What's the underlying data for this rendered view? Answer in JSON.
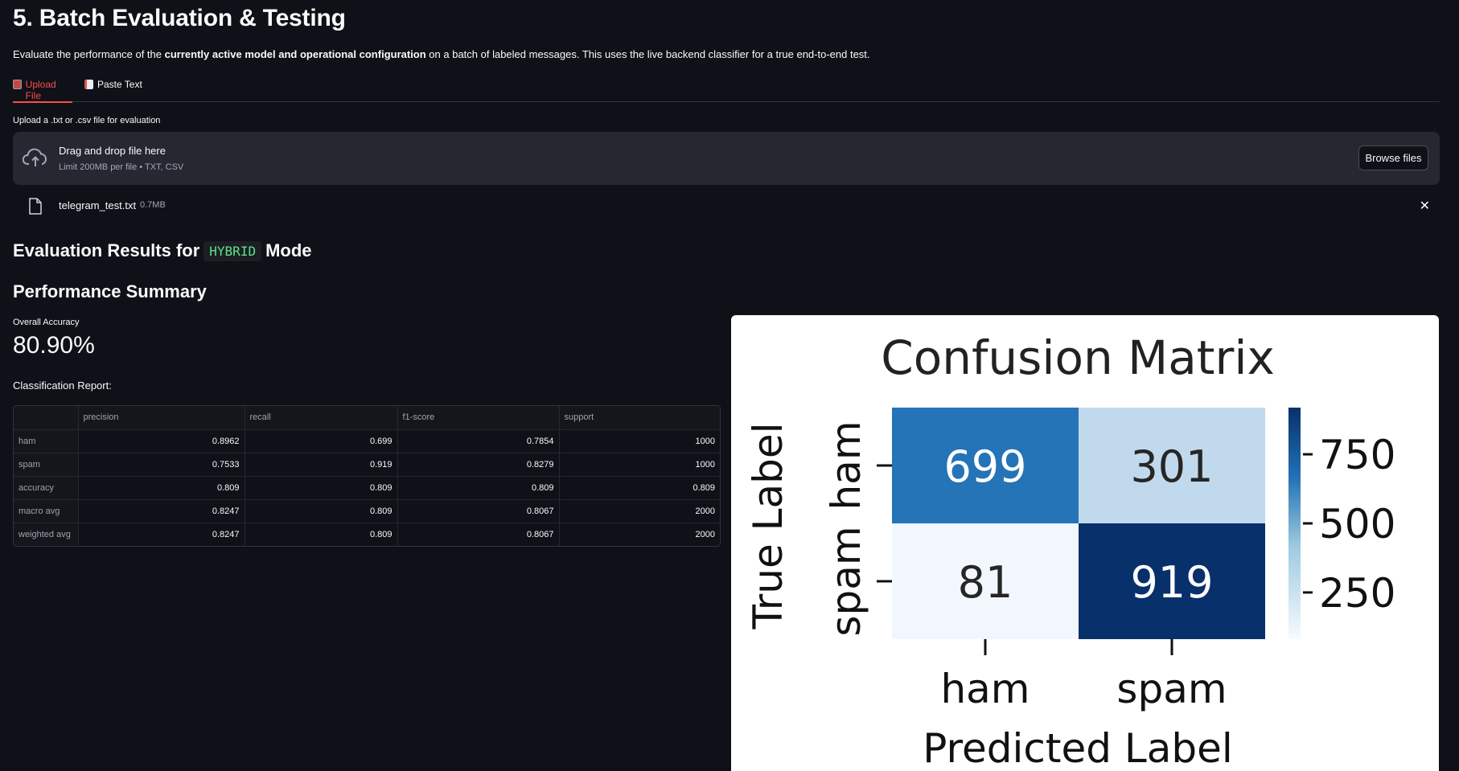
{
  "page": {
    "title": "5. Batch Evaluation & Testing",
    "intro_prefix": "Evaluate the performance of the ",
    "intro_bold": "currently active model and operational configuration",
    "intro_suffix": " on a batch of labeled messages. This uses the live backend classifier for a true end-to-end test."
  },
  "tabs": [
    {
      "label": "Upload File",
      "icon": "upload-icon",
      "active": true
    },
    {
      "label": "Paste Text",
      "icon": "document-icon",
      "active": false
    }
  ],
  "uploader": {
    "label": "Upload a .txt or .csv file for evaluation",
    "drop_title": "Drag and drop file here",
    "drop_sub": "Limit 200MB per file • TXT, CSV",
    "browse_label": "Browse files",
    "file_name": "telegram_test.txt",
    "file_size": "0.7MB"
  },
  "results": {
    "heading_prefix": "Evaluation Results for",
    "mode": "HYBRID",
    "heading_suffix": "Mode",
    "summary_heading": "Performance Summary",
    "metric_label": "Overall Accuracy",
    "metric_value": "80.90%",
    "report_label": "Classification Report:"
  },
  "report": {
    "columns": [
      "",
      "precision",
      "recall",
      "f1-score",
      "support"
    ],
    "rows": [
      [
        "ham",
        "0.8962",
        "0.699",
        "0.7854",
        "1000"
      ],
      [
        "spam",
        "0.7533",
        "0.919",
        "0.8279",
        "1000"
      ],
      [
        "accuracy",
        "0.809",
        "0.809",
        "0.809",
        "0.809"
      ],
      [
        "macro avg",
        "0.8247",
        "0.809",
        "0.8067",
        "2000"
      ],
      [
        "weighted avg",
        "0.8247",
        "0.809",
        "0.8067",
        "2000"
      ]
    ]
  },
  "chart_data": {
    "type": "heatmap",
    "title": "Confusion Matrix",
    "xlabel": "Predicted Label",
    "ylabel": "True Label",
    "x_categories": [
      "ham",
      "spam"
    ],
    "y_categories": [
      "ham",
      "spam"
    ],
    "values": [
      [
        699,
        301
      ],
      [
        81,
        919
      ]
    ],
    "colormap": "Blues",
    "colorbar_ticks": [
      750,
      500,
      250
    ],
    "colors": {
      "c699": "#2474b7",
      "c301": "#c1d9ed",
      "c81": "#f2f7fd",
      "c919": "#08306b",
      "cbar_top": "#08306b",
      "cbar_bottom": "#f7fbff"
    }
  }
}
